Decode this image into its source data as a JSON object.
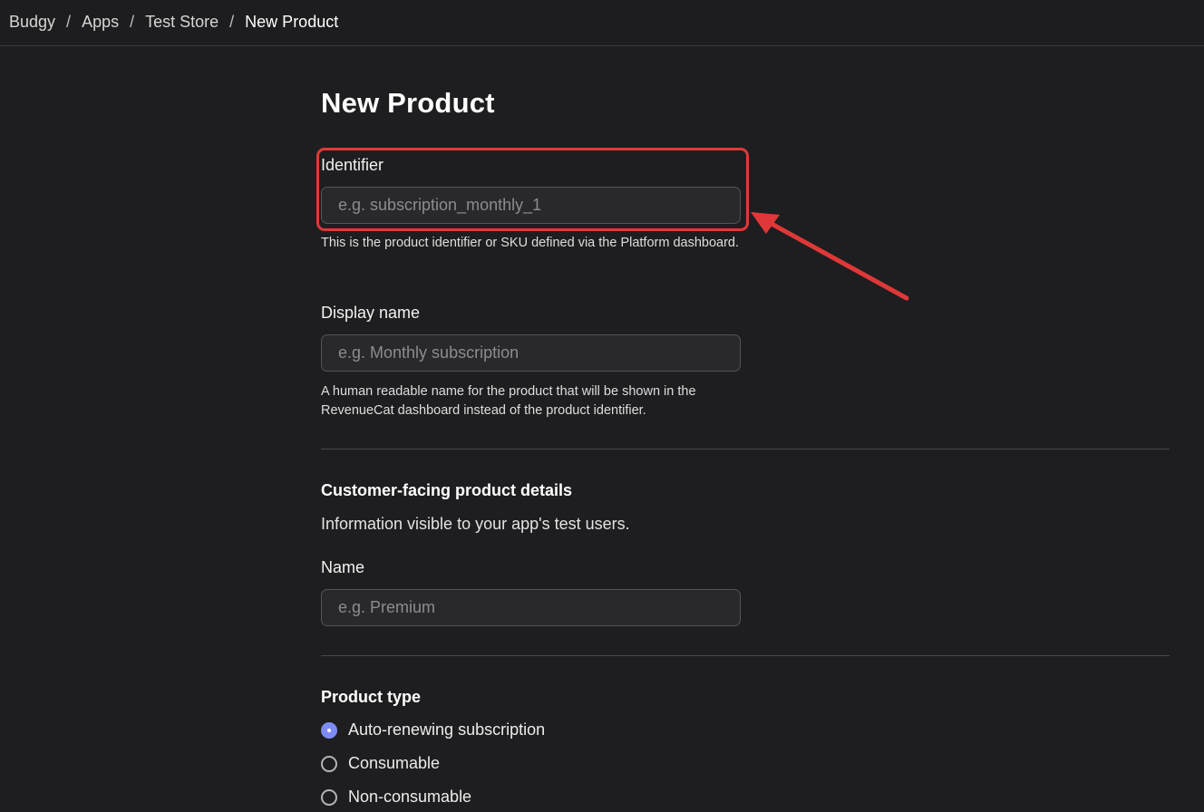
{
  "breadcrumb": {
    "items": [
      "Budgy",
      "Apps",
      "Test Store"
    ],
    "current": "New Product",
    "separator": "/"
  },
  "page": {
    "title": "New Product"
  },
  "identifier": {
    "label": "Identifier",
    "placeholder": "e.g. subscription_monthly_1",
    "value": "",
    "help": "This is the product identifier or SKU defined via the Platform dashboard."
  },
  "display_name": {
    "label": "Display name",
    "placeholder": "e.g. Monthly subscription",
    "value": "",
    "help": "A human readable name for the product that will be shown in the RevenueCat dashboard instead of the product identifier."
  },
  "customer_details": {
    "title": "Customer-facing product details",
    "subtitle": "Information visible to your app's test users.",
    "name_label": "Name",
    "name_placeholder": "e.g. Premium",
    "name_value": ""
  },
  "product_type": {
    "title": "Product type",
    "options": [
      {
        "label": "Auto-renewing subscription",
        "selected": true
      },
      {
        "label": "Consumable",
        "selected": false
      },
      {
        "label": "Non-consumable",
        "selected": false
      }
    ]
  },
  "annotation": {
    "color": "#e03838",
    "accent": "#7d8cf5"
  }
}
